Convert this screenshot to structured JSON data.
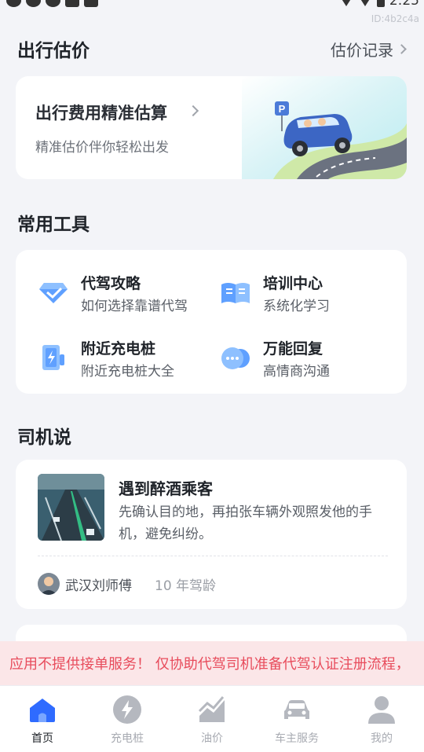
{
  "status_bar": {
    "time": "2:25"
  },
  "page_id": "ID:4b2c4a",
  "estimate_section": {
    "title": "出行估价",
    "history_link": "估价记录",
    "card_title": "出行费用精准估算",
    "card_subtitle": "精准估价伴你轻松出发",
    "parking_sign": "P"
  },
  "tools_section": {
    "title": "常用工具",
    "items": [
      {
        "name": "代驾攻略",
        "desc": "如何选择靠谱代驾",
        "icon": "diamond-check-icon"
      },
      {
        "name": "培训中心",
        "desc": "系统化学习",
        "icon": "book-icon"
      },
      {
        "name": "附近充电桩",
        "desc": "附近充电桩大全",
        "icon": "charger-icon"
      },
      {
        "name": "万能回复",
        "desc": "高情商沟通",
        "icon": "chat-bubble-icon"
      }
    ]
  },
  "driver_section": {
    "title": "司机说",
    "posts": [
      {
        "title": "遇到醉酒乘客",
        "body": "先确认目的地，再拍张车辆外观照发他的手机，避免纠纷。",
        "author": "武汉刘师傅",
        "experience": "10 年驾龄"
      }
    ]
  },
  "notice": {
    "text": "应用不提供接单服务！ 仅协助代驾司机准备代驾认证注册流程，"
  },
  "tab_bar": {
    "tabs": [
      {
        "label": "首页",
        "icon": "home-icon",
        "active": true
      },
      {
        "label": "充电桩",
        "icon": "lightning-icon",
        "active": false
      },
      {
        "label": "油价",
        "icon": "trend-chart-icon",
        "active": false
      },
      {
        "label": "车主服务",
        "icon": "car-icon",
        "active": false
      },
      {
        "label": "我的",
        "icon": "user-icon",
        "active": false
      }
    ]
  },
  "colors": {
    "accent": "#2f6bff",
    "notice_text": "#e84c5c",
    "notice_bg": "#fbe6e8"
  }
}
